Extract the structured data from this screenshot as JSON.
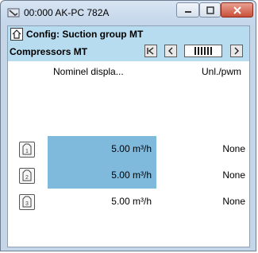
{
  "window": {
    "title": "00:000 AK-PC 782A"
  },
  "config": {
    "title": "Config: Suction group MT"
  },
  "group": {
    "title": "Compressors MT"
  },
  "columns": {
    "displacement": "Nominel displa...",
    "unloader": "Unl./pwm"
  },
  "rows": [
    {
      "number": "1",
      "displacement": "5.00 m³/h",
      "unloader": "None",
      "highlighted": true
    },
    {
      "number": "2",
      "displacement": "5.00 m³/h",
      "unloader": "None",
      "highlighted": true
    },
    {
      "number": "3",
      "displacement": "5.00 m³/h",
      "unloader": "None",
      "highlighted": false
    }
  ],
  "icons": {
    "app": "probe-icon",
    "home": "home-icon",
    "minimize": "minimize-icon",
    "maximize": "maximize-icon",
    "close": "close-icon",
    "first": "first-page-icon",
    "prev": "previous-page-icon",
    "next": "next-page-icon",
    "row": "compressor-icon"
  },
  "colors": {
    "header_bg": "#b7dcf0",
    "selected_cell": "#7fbadd",
    "close_button": "#c9503a"
  }
}
